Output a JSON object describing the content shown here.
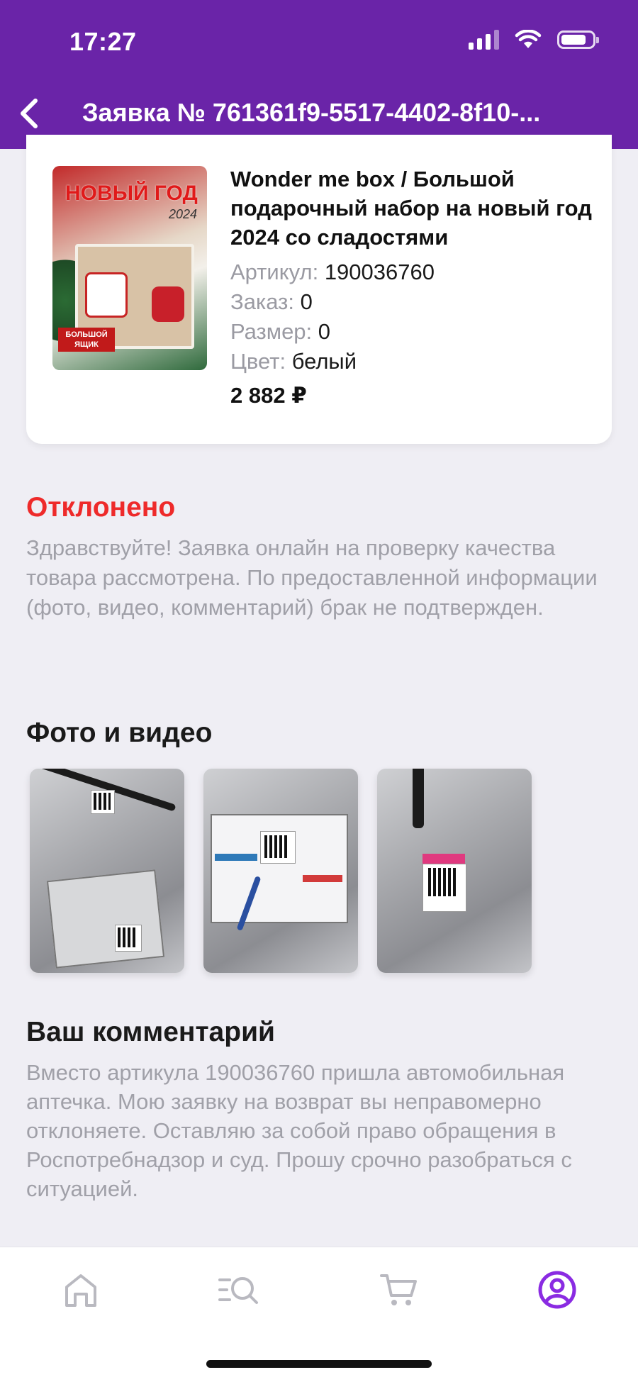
{
  "status_bar": {
    "time": "17:27"
  },
  "header": {
    "title": "Заявка № 761361f9-5517-4402-8f10-...",
    "accent_color": "#6a24a8"
  },
  "product": {
    "name": "Wonder me box / Большой подарочный набор на новый год 2024 со сладостями",
    "image_text": {
      "headline": "НОВЫЙ ГОД",
      "year": "2024",
      "badge": "БОЛЬШОЙ ЯЩИК"
    },
    "fields": [
      {
        "key": "Артикул:",
        "value": "190036760"
      },
      {
        "key": "Заказ:",
        "value": "0"
      },
      {
        "key": "Размер:",
        "value": "0"
      },
      {
        "key": "Цвет:",
        "value": "белый"
      }
    ],
    "price": "2 882 ₽"
  },
  "status": {
    "label": "Отклонено",
    "color": "#ee2a2a",
    "message": "Здравствуйте! Заявка онлайн на проверку качества товара рассмотрена. По предоставленной информации (фото, видео, комментарий) брак не подтвержден."
  },
  "media": {
    "title": "Фото и видео",
    "photos": [
      "photo-1",
      "photo-2",
      "photo-3"
    ]
  },
  "comment": {
    "title": "Ваш комментарий",
    "text": "Вместо артикула 190036760 пришла автомобильная аптечка. Мою заявку на возврат вы неправомерно отклоняете. Оставляю за собой право обращения в Роспотребнадзор и суд. Прошу срочно разобраться с ситуацией."
  },
  "tabbar": {
    "tabs": [
      {
        "icon": "home-icon",
        "active": false
      },
      {
        "icon": "catalog-search-icon",
        "active": false
      },
      {
        "icon": "cart-icon",
        "active": false
      },
      {
        "icon": "profile-icon",
        "active": true
      }
    ],
    "active_color": "#8a2be2",
    "inactive_color": "#b9b9c0"
  }
}
